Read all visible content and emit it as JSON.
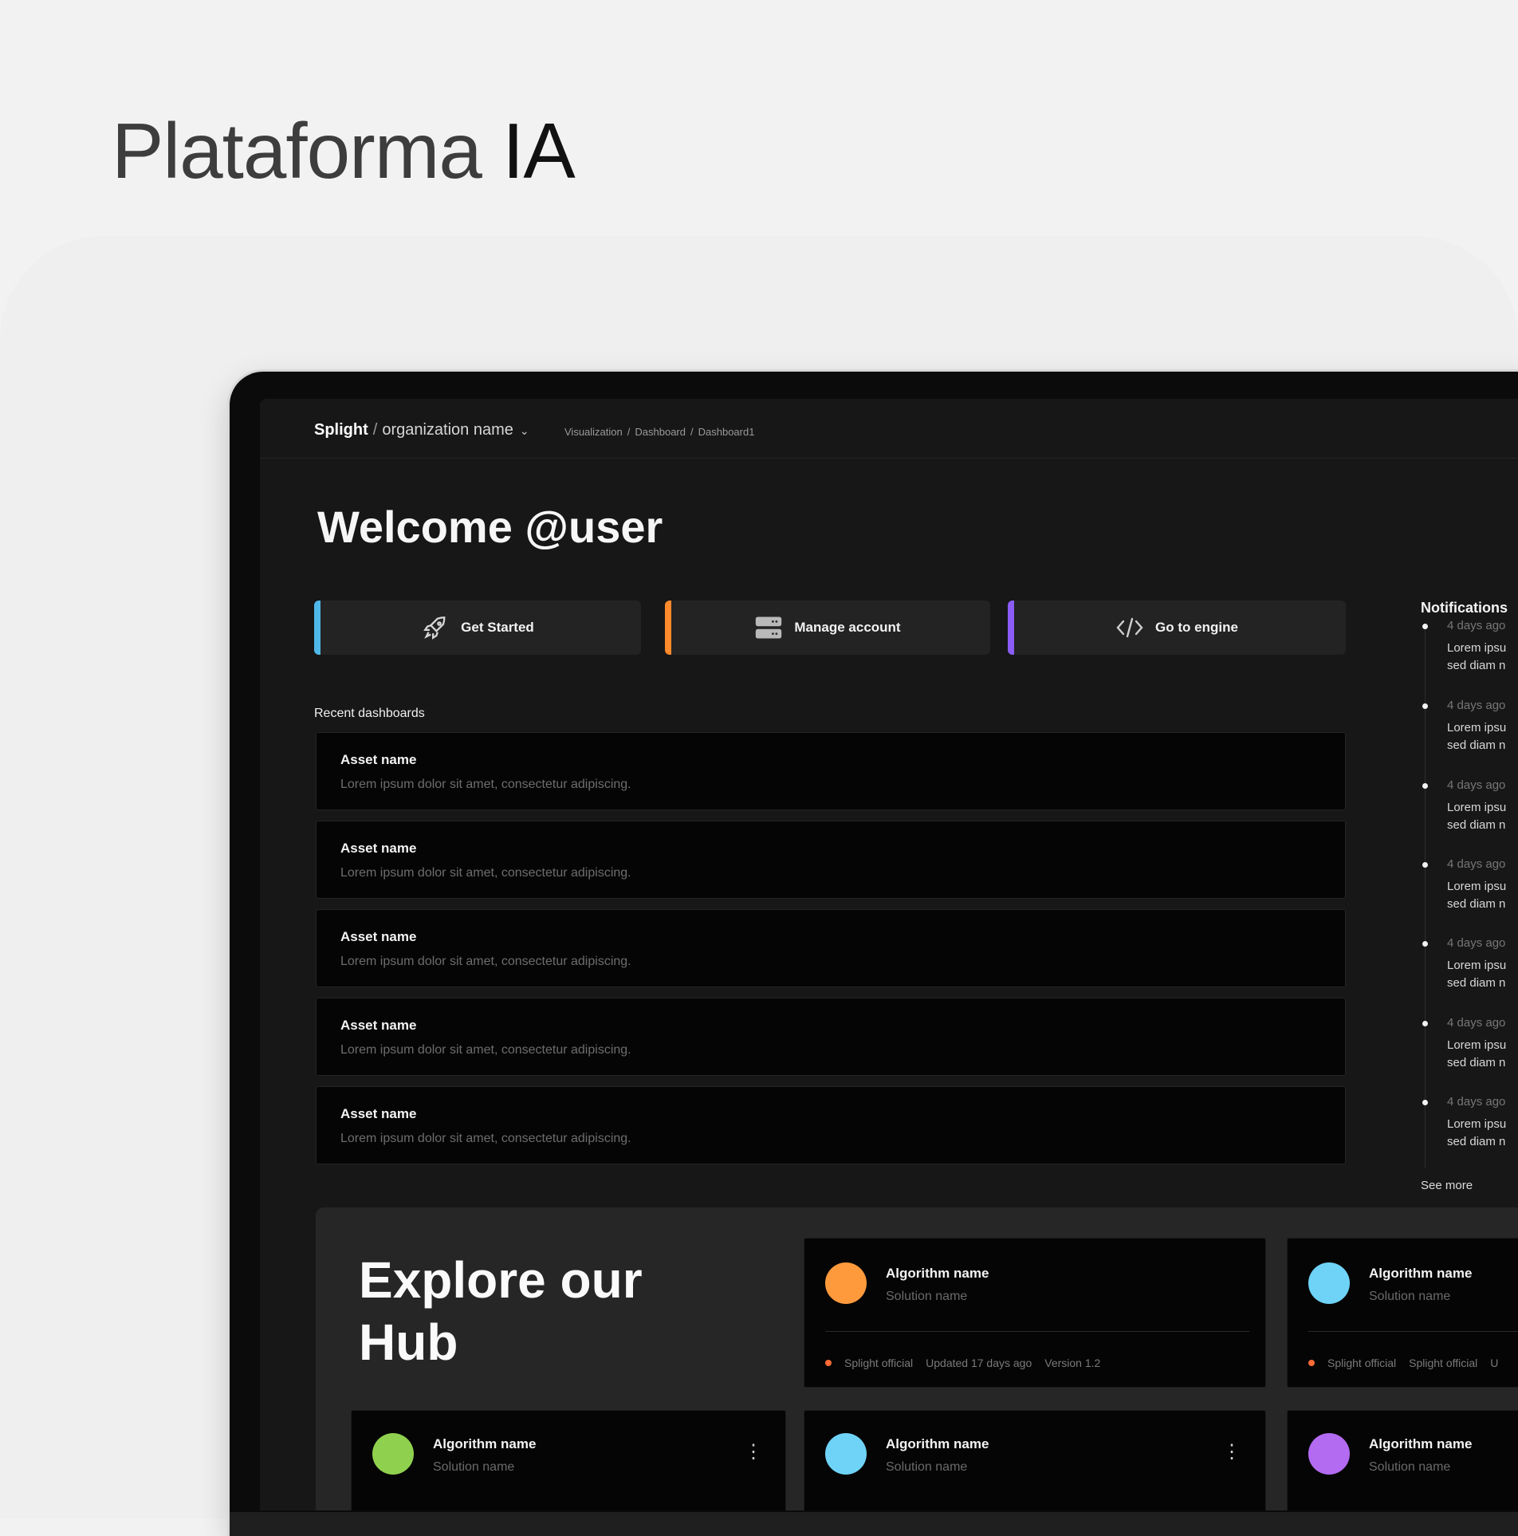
{
  "page": {
    "title_regular": "Plataforma ",
    "title_strong": "IA"
  },
  "topbar": {
    "brand": "Splight",
    "separator": "/",
    "org_name": "organization name",
    "breadcrumb": [
      "Visualization",
      "Dashboard",
      "Dashboard1"
    ]
  },
  "welcome": "Welcome @user",
  "actions": [
    {
      "label": "Get Started",
      "icon": "rocket-icon",
      "accent": "#4fb8e8"
    },
    {
      "label": "Manage account",
      "icon": "server-icon",
      "accent": "#ff8a2b"
    },
    {
      "label": "Go to engine",
      "icon": "code-icon",
      "accent": "#8b5cf6"
    }
  ],
  "recent": {
    "label": "Recent dashboards",
    "items": [
      {
        "name": "Asset name",
        "desc": "Lorem ipsum dolor sit amet, consectetur adipiscing."
      },
      {
        "name": "Asset name",
        "desc": "Lorem ipsum dolor sit amet, consectetur adipiscing."
      },
      {
        "name": "Asset name",
        "desc": "Lorem ipsum dolor sit amet, consectetur adipiscing."
      },
      {
        "name": "Asset name",
        "desc": "Lorem ipsum dolor sit amet, consectetur adipiscing."
      },
      {
        "name": "Asset name",
        "desc": "Lorem ipsum dolor sit amet, consectetur adipiscing."
      }
    ]
  },
  "notifications": {
    "title": "Notifications",
    "items": [
      {
        "when": "4 days ago",
        "text": "Lorem ipsu\nsed diam n"
      },
      {
        "when": "4 days ago",
        "text": "Lorem ipsu\nsed diam n"
      },
      {
        "when": "4 days ago",
        "text": "Lorem ipsu\nsed diam n"
      },
      {
        "when": "4 days ago",
        "text": "Lorem ipsu\nsed diam n"
      },
      {
        "when": "4 days ago",
        "text": "Lorem ipsu\nsed diam n"
      },
      {
        "when": "4 days ago",
        "text": "Lorem ipsu\nsed diam n"
      },
      {
        "when": "4 days ago",
        "text": "Lorem ipsu\nsed diam n"
      }
    ],
    "see_more": "See more"
  },
  "hub": {
    "title": "Explore our Hub",
    "featured": [
      {
        "name": "Algorithm name",
        "solution": "Solution name",
        "color": "#ff9a3c",
        "meta": [
          "Splight official",
          "Updated 17 days ago",
          "Version 1.2"
        ]
      },
      {
        "name": "Algorithm name",
        "solution": "Solution name",
        "color": "#6fd3f7",
        "meta": [
          "Splight official",
          "Splight official",
          "U"
        ]
      }
    ],
    "cards": [
      {
        "name": "Algorithm name",
        "solution": "Solution name",
        "color": "#8fd14f",
        "more": "⋮"
      },
      {
        "name": "Algorithm name",
        "solution": "Solution name",
        "color": "#6fd3f7",
        "more": "⋮"
      },
      {
        "name": "Algorithm name",
        "solution": "Solution name",
        "color": "#b36bf2"
      }
    ]
  }
}
